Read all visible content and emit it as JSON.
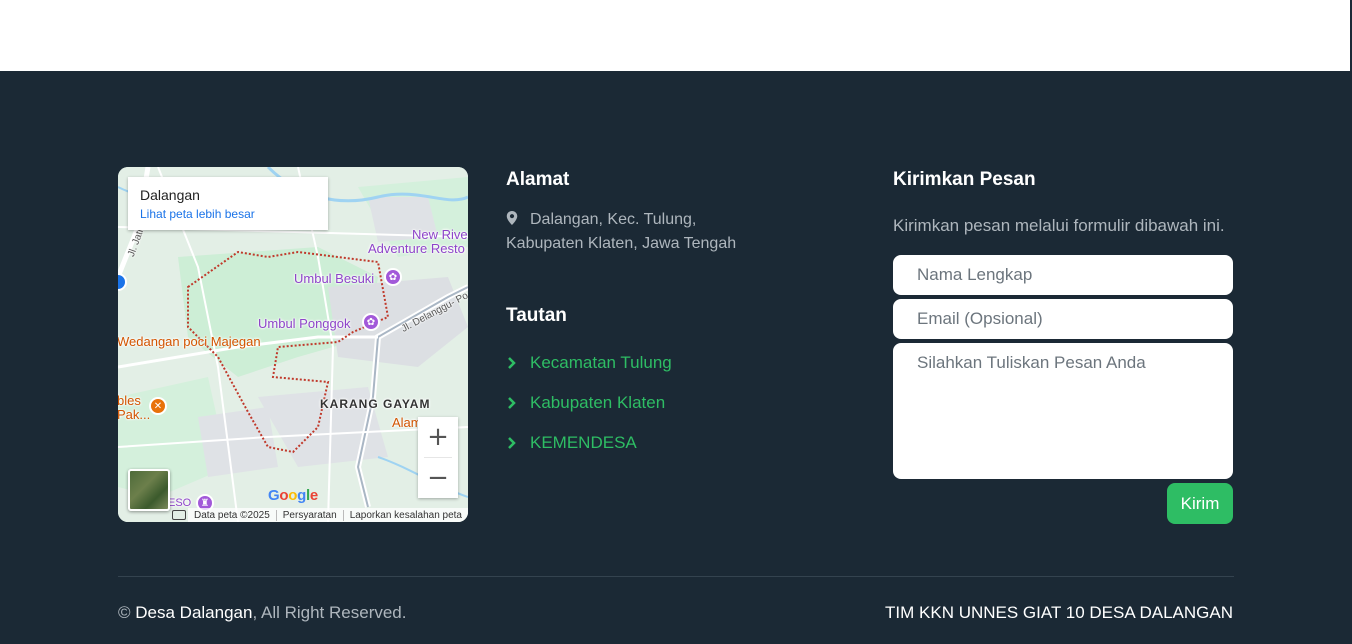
{
  "map": {
    "place_name": "Dalangan",
    "view_larger": "Lihat peta lebih besar",
    "labels": {
      "new_river": "New Rive",
      "adventure": "Adventure Resto",
      "umbul_besuki": "Umbul Besuki",
      "umbul_ponggok": "Umbul Ponggok",
      "wedangan": "Wedangan poci Majegan",
      "karang_gayam": "KARANG GAYAM",
      "bles": "bles",
      "pak": "Pak...",
      "alam": "Alam",
      "road_delanggu": "Jl. Delanggu- Po",
      "road_jatin": "Jl. Jatin",
      "eso": "ESO"
    },
    "zoom_in": "+",
    "zoom_out": "−",
    "google": [
      "G",
      "o",
      "o",
      "g",
      "l",
      "e"
    ],
    "attribution": [
      "Data peta ©2025",
      "Persyaratan",
      "Laporkan kesalahan peta"
    ]
  },
  "address": {
    "title": "Alamat",
    "text": "Dalangan, Kec. Tulung, Kabupaten Klaten, Jawa Tengah"
  },
  "links": {
    "title": "Tautan",
    "items": [
      "Kecamatan Tulung",
      "Kabupaten Klaten",
      "KEMENDESA"
    ]
  },
  "contact": {
    "title": "Kirimkan Pesan",
    "description": "Kirimkan pesan melalui formulir dibawah ini.",
    "name_placeholder": "Nama Lengkap",
    "email_placeholder": "Email (Opsional)",
    "message_placeholder": "Silahkan Tuliskan Pesan Anda",
    "submit": "Kirim"
  },
  "footer": {
    "copy_symbol": "©",
    "site_name": "Desa Dalangan",
    "rights": ", All Right Reserved.",
    "credit": "TIM KKN UNNES GIAT 10 DESA DALANGAN"
  },
  "colors": {
    "footer_bg": "#1b2935",
    "accent_green": "#2ebd64",
    "muted_text": "#aeb6bd"
  }
}
